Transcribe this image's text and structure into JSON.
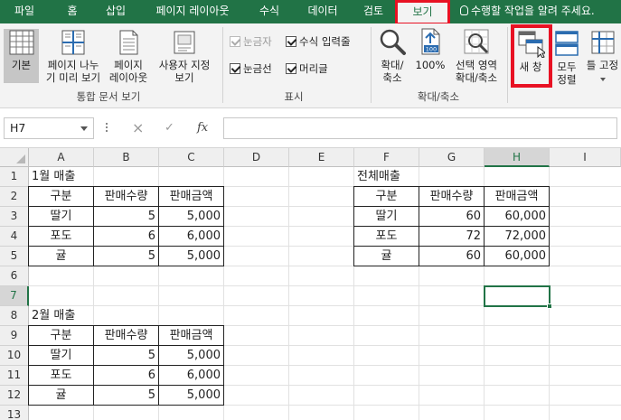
{
  "tabs": [
    "파일",
    "홈",
    "삽입",
    "페이지 레이아웃",
    "수식",
    "데이터",
    "검토",
    "보기"
  ],
  "active_tab": "보기",
  "tell_me": "수행할 작업을 알려 주세요.",
  "ribbon": {
    "workbook_views": {
      "label": "통합 문서 보기",
      "normal": "기본",
      "page_break_line1": "페이지 나누",
      "page_break_line2": "기 미리 보기",
      "page_layout_line1": "페이지",
      "page_layout_line2": "레이아웃",
      "custom_line1": "사용자 지정",
      "custom_line2": "보기"
    },
    "show": {
      "label": "표시",
      "ruler": "눈금자",
      "formula_bar": "수식 입력줄",
      "gridlines": "눈금선",
      "headings": "머리글"
    },
    "zoom": {
      "label": "확대/축소",
      "zoom_line1": "확대/",
      "zoom_line2": "축소",
      "hundred": "100%",
      "hundred_badge": "100",
      "selection_line1": "선택 영역",
      "selection_line2": "확대/축소"
    },
    "window": {
      "new_window_line1": "새 창",
      "arrange_line1": "모두",
      "arrange_line2": "정렬",
      "freeze": "틀 고정"
    }
  },
  "formula_bar": {
    "name_box": "H7",
    "cancel": "×",
    "enter": "✓",
    "fx": "fx",
    "value": ""
  },
  "columns": [
    "A",
    "B",
    "C",
    "D",
    "E",
    "F",
    "G",
    "H",
    "I"
  ],
  "selected_column": "H",
  "rows": [
    "1",
    "2",
    "3",
    "4",
    "5",
    "6",
    "7",
    "8",
    "9",
    "10",
    "11",
    "12",
    "13"
  ],
  "selected_row": "7",
  "cells": {
    "A1": "1월 매출",
    "A2": "구분",
    "B2": "판매수량",
    "C2": "판매금액",
    "A3": "딸기",
    "B3": "5",
    "C3": "5,000",
    "A4": "포도",
    "B4": "6",
    "C4": "6,000",
    "A5": "귤",
    "B5": "5",
    "C5": "5,000",
    "F1": "전체매출",
    "F2": "구분",
    "G2": "판매수량",
    "H2": "판매금액",
    "F3": "딸기",
    "G3": "60",
    "H3": "60,000",
    "F4": "포도",
    "G4": "72",
    "H4": "72,000",
    "F5": "귤",
    "G5": "60",
    "H5": "60,000",
    "A8": "2월 매출",
    "A9": "구분",
    "B9": "판매수량",
    "C9": "판매금액",
    "A10": "딸기",
    "B10": "5",
    "C10": "5,000",
    "A11": "포도",
    "B11": "6",
    "C11": "6,000",
    "A12": "귤",
    "B12": "5",
    "C12": "5,000"
  },
  "colors": {
    "excel_green": "#217346",
    "highlight_red": "#e81123",
    "ribbon_bg": "#f3f3f3"
  }
}
